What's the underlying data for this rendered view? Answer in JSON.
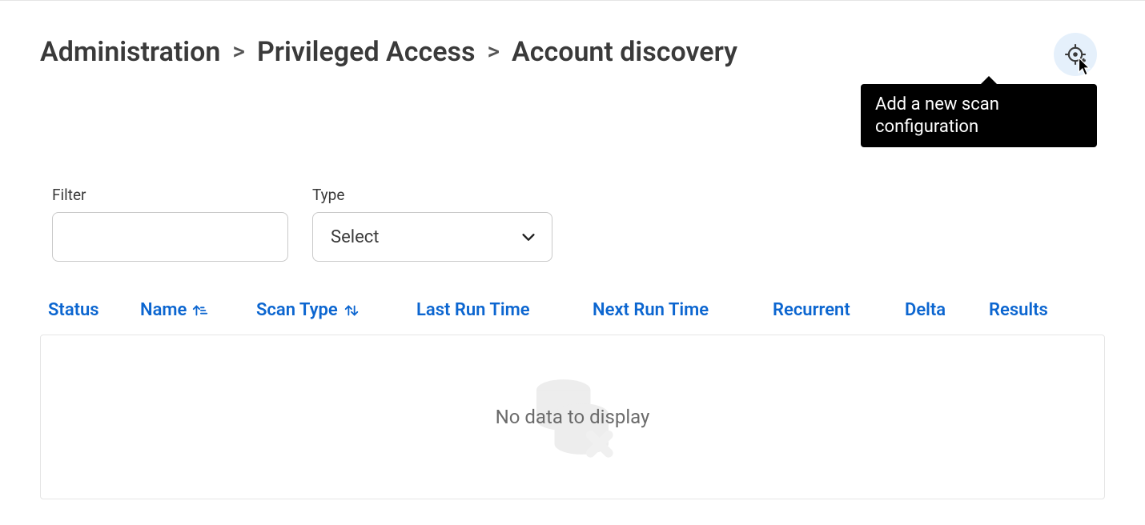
{
  "breadcrumb": {
    "items": [
      "Administration",
      "Privileged Access",
      "Account discovery"
    ],
    "separator": ">"
  },
  "action": {
    "tooltip": "Add a new scan configuration"
  },
  "filters": {
    "filter_label": "Filter",
    "filter_value": "",
    "type_label": "Type",
    "type_selected": "Select"
  },
  "table": {
    "columns": {
      "status": "Status",
      "name": "Name",
      "scantype": "Scan Type",
      "lastrun": "Last Run Time",
      "nextrun": "Next Run Time",
      "recur": "Recurrent",
      "delta": "Delta",
      "results": "Results"
    },
    "rows": [],
    "empty_message": "No data to display"
  }
}
